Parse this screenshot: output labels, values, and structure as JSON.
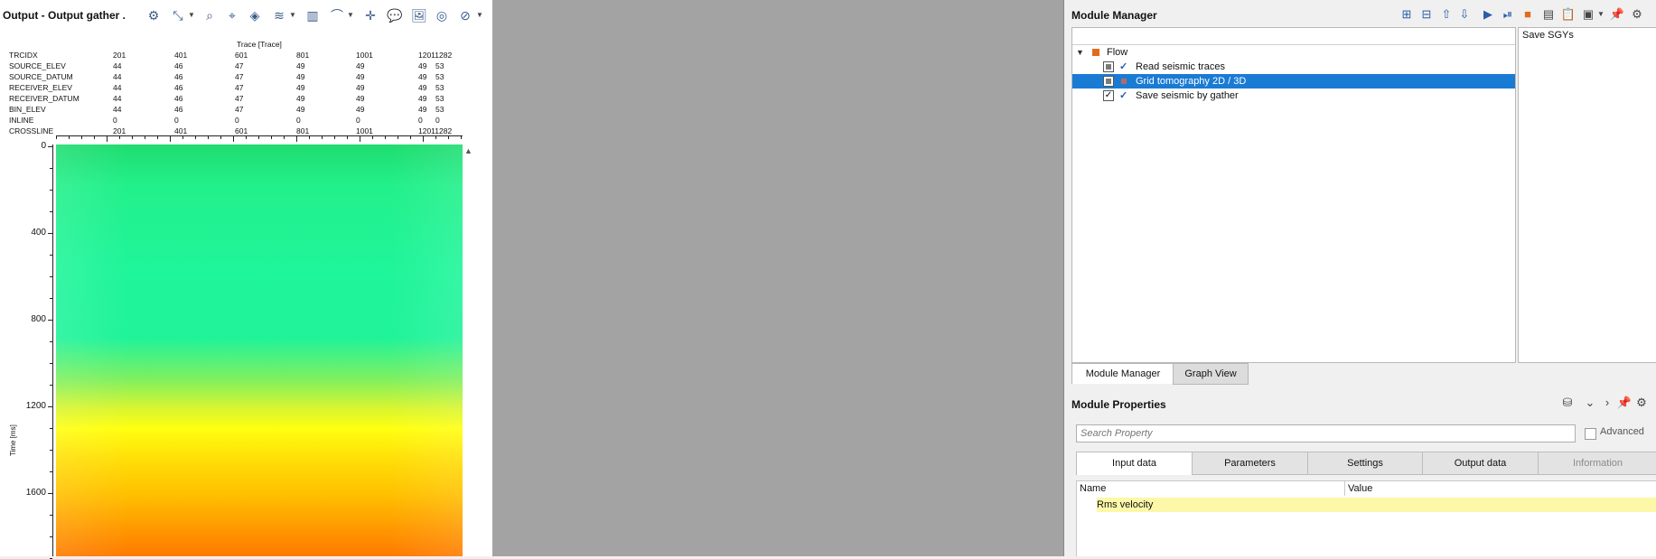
{
  "left_panel": {
    "title": "Output - Output gather .",
    "trace_axis_label": "Trace [Trace]",
    "header_rows": [
      {
        "name": "TRCIDX",
        "values": [
          "201",
          "401",
          "601",
          "801",
          "1001",
          "12011282"
        ]
      },
      {
        "name": "SOURCE_ELEV",
        "values": [
          "44",
          "46",
          "47",
          "49",
          "49",
          "49",
          "53"
        ]
      },
      {
        "name": "SOURCE_DATUM",
        "values": [
          "44",
          "46",
          "47",
          "49",
          "49",
          "49",
          "53"
        ]
      },
      {
        "name": "RECEIVER_ELEV",
        "values": [
          "44",
          "46",
          "47",
          "49",
          "49",
          "49",
          "53"
        ]
      },
      {
        "name": "RECEIVER_DATUM",
        "values": [
          "44",
          "46",
          "47",
          "49",
          "49",
          "49",
          "53"
        ]
      },
      {
        "name": "BIN_ELEV",
        "values": [
          "44",
          "46",
          "47",
          "49",
          "49",
          "49",
          "53"
        ]
      },
      {
        "name": "INLINE",
        "values": [
          "0",
          "0",
          "0",
          "0",
          "0",
          "0",
          "0"
        ]
      },
      {
        "name": "CROSSLINE",
        "values": [
          "201",
          "401",
          "601",
          "801",
          "1001",
          "12011282"
        ]
      }
    ],
    "y_axis_title": "Time [ms]",
    "y_ticks": [
      "0",
      "400",
      "800",
      "1200",
      "1600"
    ]
  },
  "module_manager": {
    "title": "Module Manager",
    "tree": [
      {
        "label": "Flow",
        "level": 0
      },
      {
        "label": "Read seismic traces",
        "level": 1,
        "checkbox": "filled",
        "enabled": true
      },
      {
        "label": "Grid tomography 2D / 3D",
        "level": 1,
        "checkbox": "filled",
        "enabled": false,
        "selected": true
      },
      {
        "label": "Save seismic by gather",
        "level": 1,
        "checkbox": "checked",
        "enabled": true
      }
    ],
    "side_panel_text": "Save SGYs",
    "tabs": [
      "Module Manager",
      "Graph View"
    ]
  },
  "module_properties": {
    "title": "Module Properties",
    "search_placeholder": "Search Property",
    "advanced_label": "Advanced",
    "tabs": [
      "Input data",
      "Parameters",
      "Settings",
      "Output data",
      "Information"
    ],
    "grid_headers": [
      "Name",
      "Value"
    ],
    "rows": [
      {
        "name": "Rms velocity",
        "value": ""
      }
    ]
  },
  "colors": {
    "selection": "#1a7bd5",
    "highlight_row": "#fdf8a8",
    "flow_square": "#e36b1c"
  }
}
